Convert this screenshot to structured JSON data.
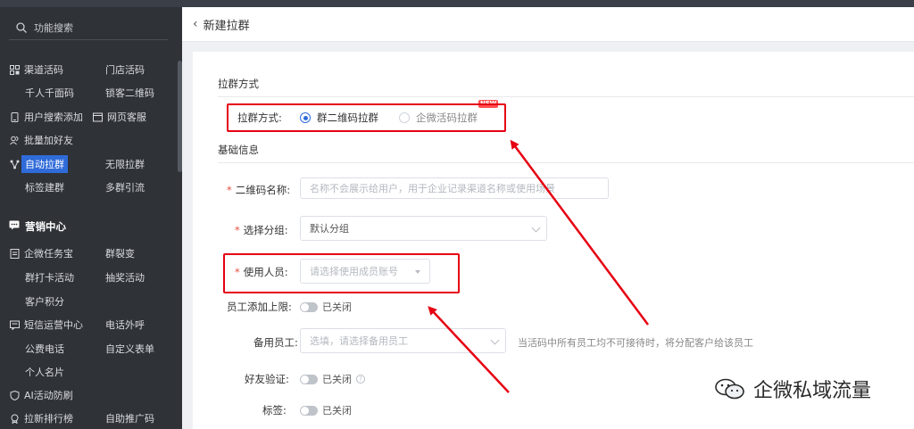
{
  "sidebar": {
    "search_label": "功能搜索",
    "items": [
      {
        "label": "渠道活码"
      },
      {
        "label": "门店活码"
      },
      {
        "label": "千人千面码"
      },
      {
        "label": "锁客二维码"
      },
      {
        "label": "用户搜索添加"
      },
      {
        "label": "网页客服"
      },
      {
        "label": "批量加好友"
      },
      {
        "label": "自动拉群"
      },
      {
        "label": "无限拉群"
      },
      {
        "label": "标签建群"
      },
      {
        "label": "多群引流"
      }
    ],
    "section_title": "营销中心",
    "marketing_items": [
      {
        "label": "企微任务宝"
      },
      {
        "label": "群裂变"
      },
      {
        "label": "群打卡活动"
      },
      {
        "label": "抽奖活动"
      },
      {
        "label": "客户积分"
      },
      {
        "label": "短信运营中心"
      },
      {
        "label": "电话外呼"
      },
      {
        "label": "公费电话"
      },
      {
        "label": "自定义表单"
      },
      {
        "label": "个人名片"
      },
      {
        "label": "AI活动防刷"
      },
      {
        "label": "拉新排行榜"
      },
      {
        "label": "自助推广码"
      }
    ]
  },
  "header": {
    "title": "新建拉群"
  },
  "form": {
    "section_method": "拉群方式",
    "method_label": "拉群方式:",
    "method_options": [
      "群二维码拉群",
      "企微活码拉群"
    ],
    "new_badge": "NEW",
    "section_basic": "基础信息",
    "qr_name_label": "二维码名称:",
    "qr_name_placeholder": "名称不会展示给用户，用于企业记录渠道名称或使用场景",
    "group_label": "选择分组:",
    "group_value": "默认分组",
    "staff_label": "使用人员:",
    "staff_placeholder": "请选择使用成员账号",
    "limit_label": "员工添加上限:",
    "limit_state": "已关闭",
    "backup_label": "备用员工:",
    "backup_placeholder": "选填，请选择备用员工",
    "backup_hint": "当活码中所有员工均不可接待时，将分配客户给该员工",
    "verify_label": "好友验证:",
    "verify_state": "已关闭",
    "tag_label": "标签:",
    "tag_state": "已关闭"
  },
  "watermark": {
    "text": "企微私域流量"
  },
  "colors": {
    "accent": "#2f6bd9",
    "highlight": "#e60012",
    "sidebar_bg": "#2f3237"
  }
}
